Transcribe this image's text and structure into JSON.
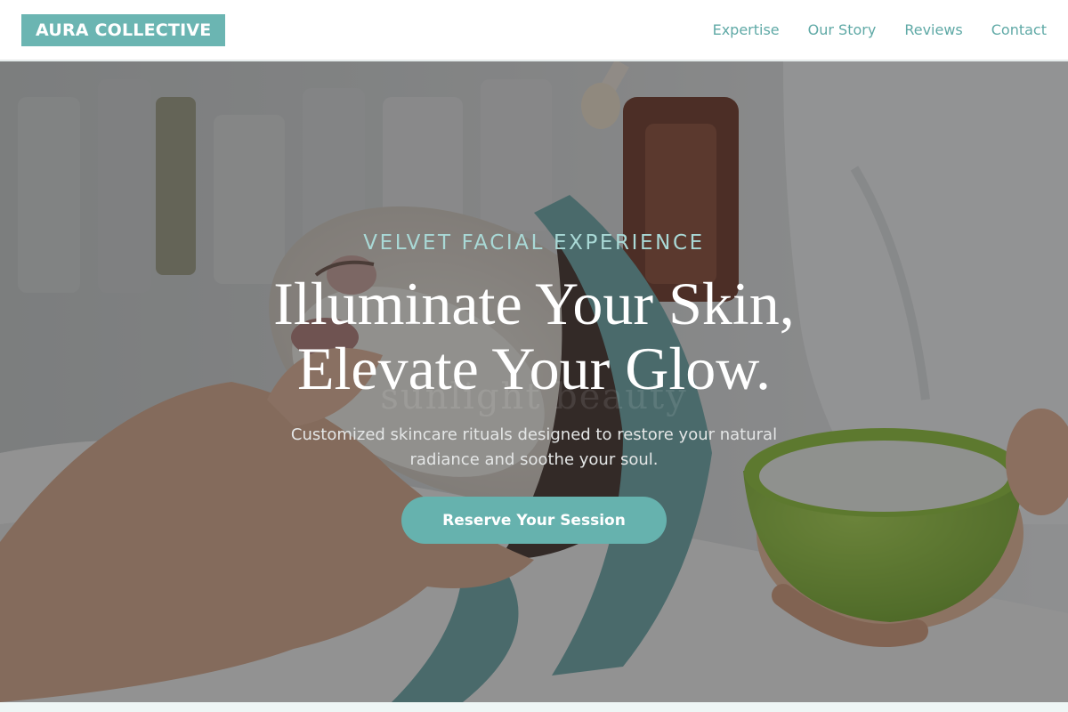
{
  "brand": {
    "name": "AURA COLLECTIVE"
  },
  "nav": {
    "links": [
      {
        "label": "Expertise"
      },
      {
        "label": "Our Story"
      },
      {
        "label": "Reviews"
      },
      {
        "label": "Contact"
      }
    ]
  },
  "hero": {
    "eyebrow": "VELVET FACIAL EXPERIENCE",
    "headline_line1": "Illuminate Your Skin,",
    "headline_line2": "Elevate Your Glow.",
    "subtext": "Customized skincare rituals designed to restore your natural radiance and soothe your soul.",
    "cta_label": "Reserve Your Session",
    "watermark": "sunlight beauty"
  },
  "colors": {
    "accent": "#6bb5b2",
    "nav_link": "#5fa9a6",
    "eyebrow": "#a9d9d6",
    "overlay": "#28282a"
  }
}
